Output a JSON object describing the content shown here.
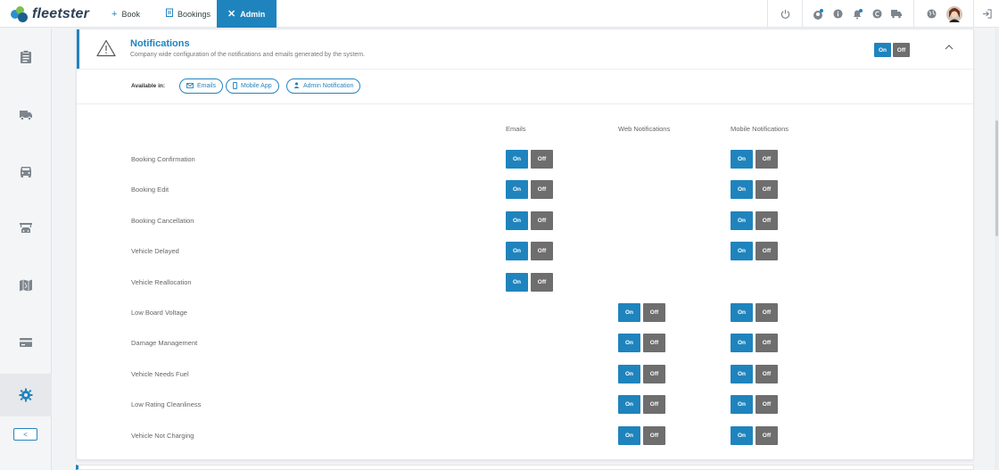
{
  "app": {
    "name": "fleetster"
  },
  "nav": {
    "tabs": [
      {
        "label": "Book",
        "icon": "plus-icon"
      },
      {
        "label": "Bookings",
        "icon": "clipboard-icon"
      },
      {
        "label": "Admin",
        "icon": "tools-icon",
        "active": true
      }
    ]
  },
  "topbar_icons": [
    "power-icon",
    "user-badge-icon",
    "info-icon",
    "bell-icon",
    "euro-icon",
    "truck-icon",
    "globe-icon",
    "avatar",
    "logout-icon"
  ],
  "sidebar": {
    "items": [
      "clipboard-list-icon",
      "van-icon",
      "car-front-icon",
      "car-wash-icon",
      "map-icon",
      "card-icon",
      "gear-icon"
    ],
    "active_index": 6,
    "collapse_label": "<"
  },
  "panel": {
    "title": "Notifications",
    "subtitle": "Company wide configuration of the notifications and emails generated by the system.",
    "toggle": {
      "on": "On",
      "off": "Off"
    },
    "available_label": "Available in:",
    "available": [
      {
        "label": "Emails",
        "icon": "mail-icon"
      },
      {
        "label": "Mobile App",
        "icon": "phone-icon"
      },
      {
        "label": "Admin Notification",
        "icon": "admin-user-icon"
      }
    ],
    "columns": [
      "Emails",
      "Web Notifications",
      "Mobile Notifications"
    ],
    "on_label": "On",
    "off_label": "Off",
    "rows": [
      {
        "label": "Booking Confirmation",
        "email": true,
        "web": false,
        "mobile": true
      },
      {
        "label": "Booking Edit",
        "email": true,
        "web": false,
        "mobile": true
      },
      {
        "label": "Booking Cancellation",
        "email": true,
        "web": false,
        "mobile": true
      },
      {
        "label": "Vehicle Delayed",
        "email": true,
        "web": false,
        "mobile": true
      },
      {
        "label": "Vehicle Reallocation",
        "email": true,
        "web": false,
        "mobile": false
      },
      {
        "label": "Low Board Voltage",
        "email": false,
        "web": true,
        "mobile": true
      },
      {
        "label": "Damage Management",
        "email": false,
        "web": true,
        "mobile": true
      },
      {
        "label": "Vehicle Needs Fuel",
        "email": false,
        "web": true,
        "mobile": true
      },
      {
        "label": "Low Rating Cleanliness",
        "email": false,
        "web": true,
        "mobile": true
      },
      {
        "label": "Vehicle Not Charging",
        "email": false,
        "web": true,
        "mobile": true
      }
    ]
  },
  "colors": {
    "accent": "#1f84bd",
    "off": "#6e6e6e"
  }
}
